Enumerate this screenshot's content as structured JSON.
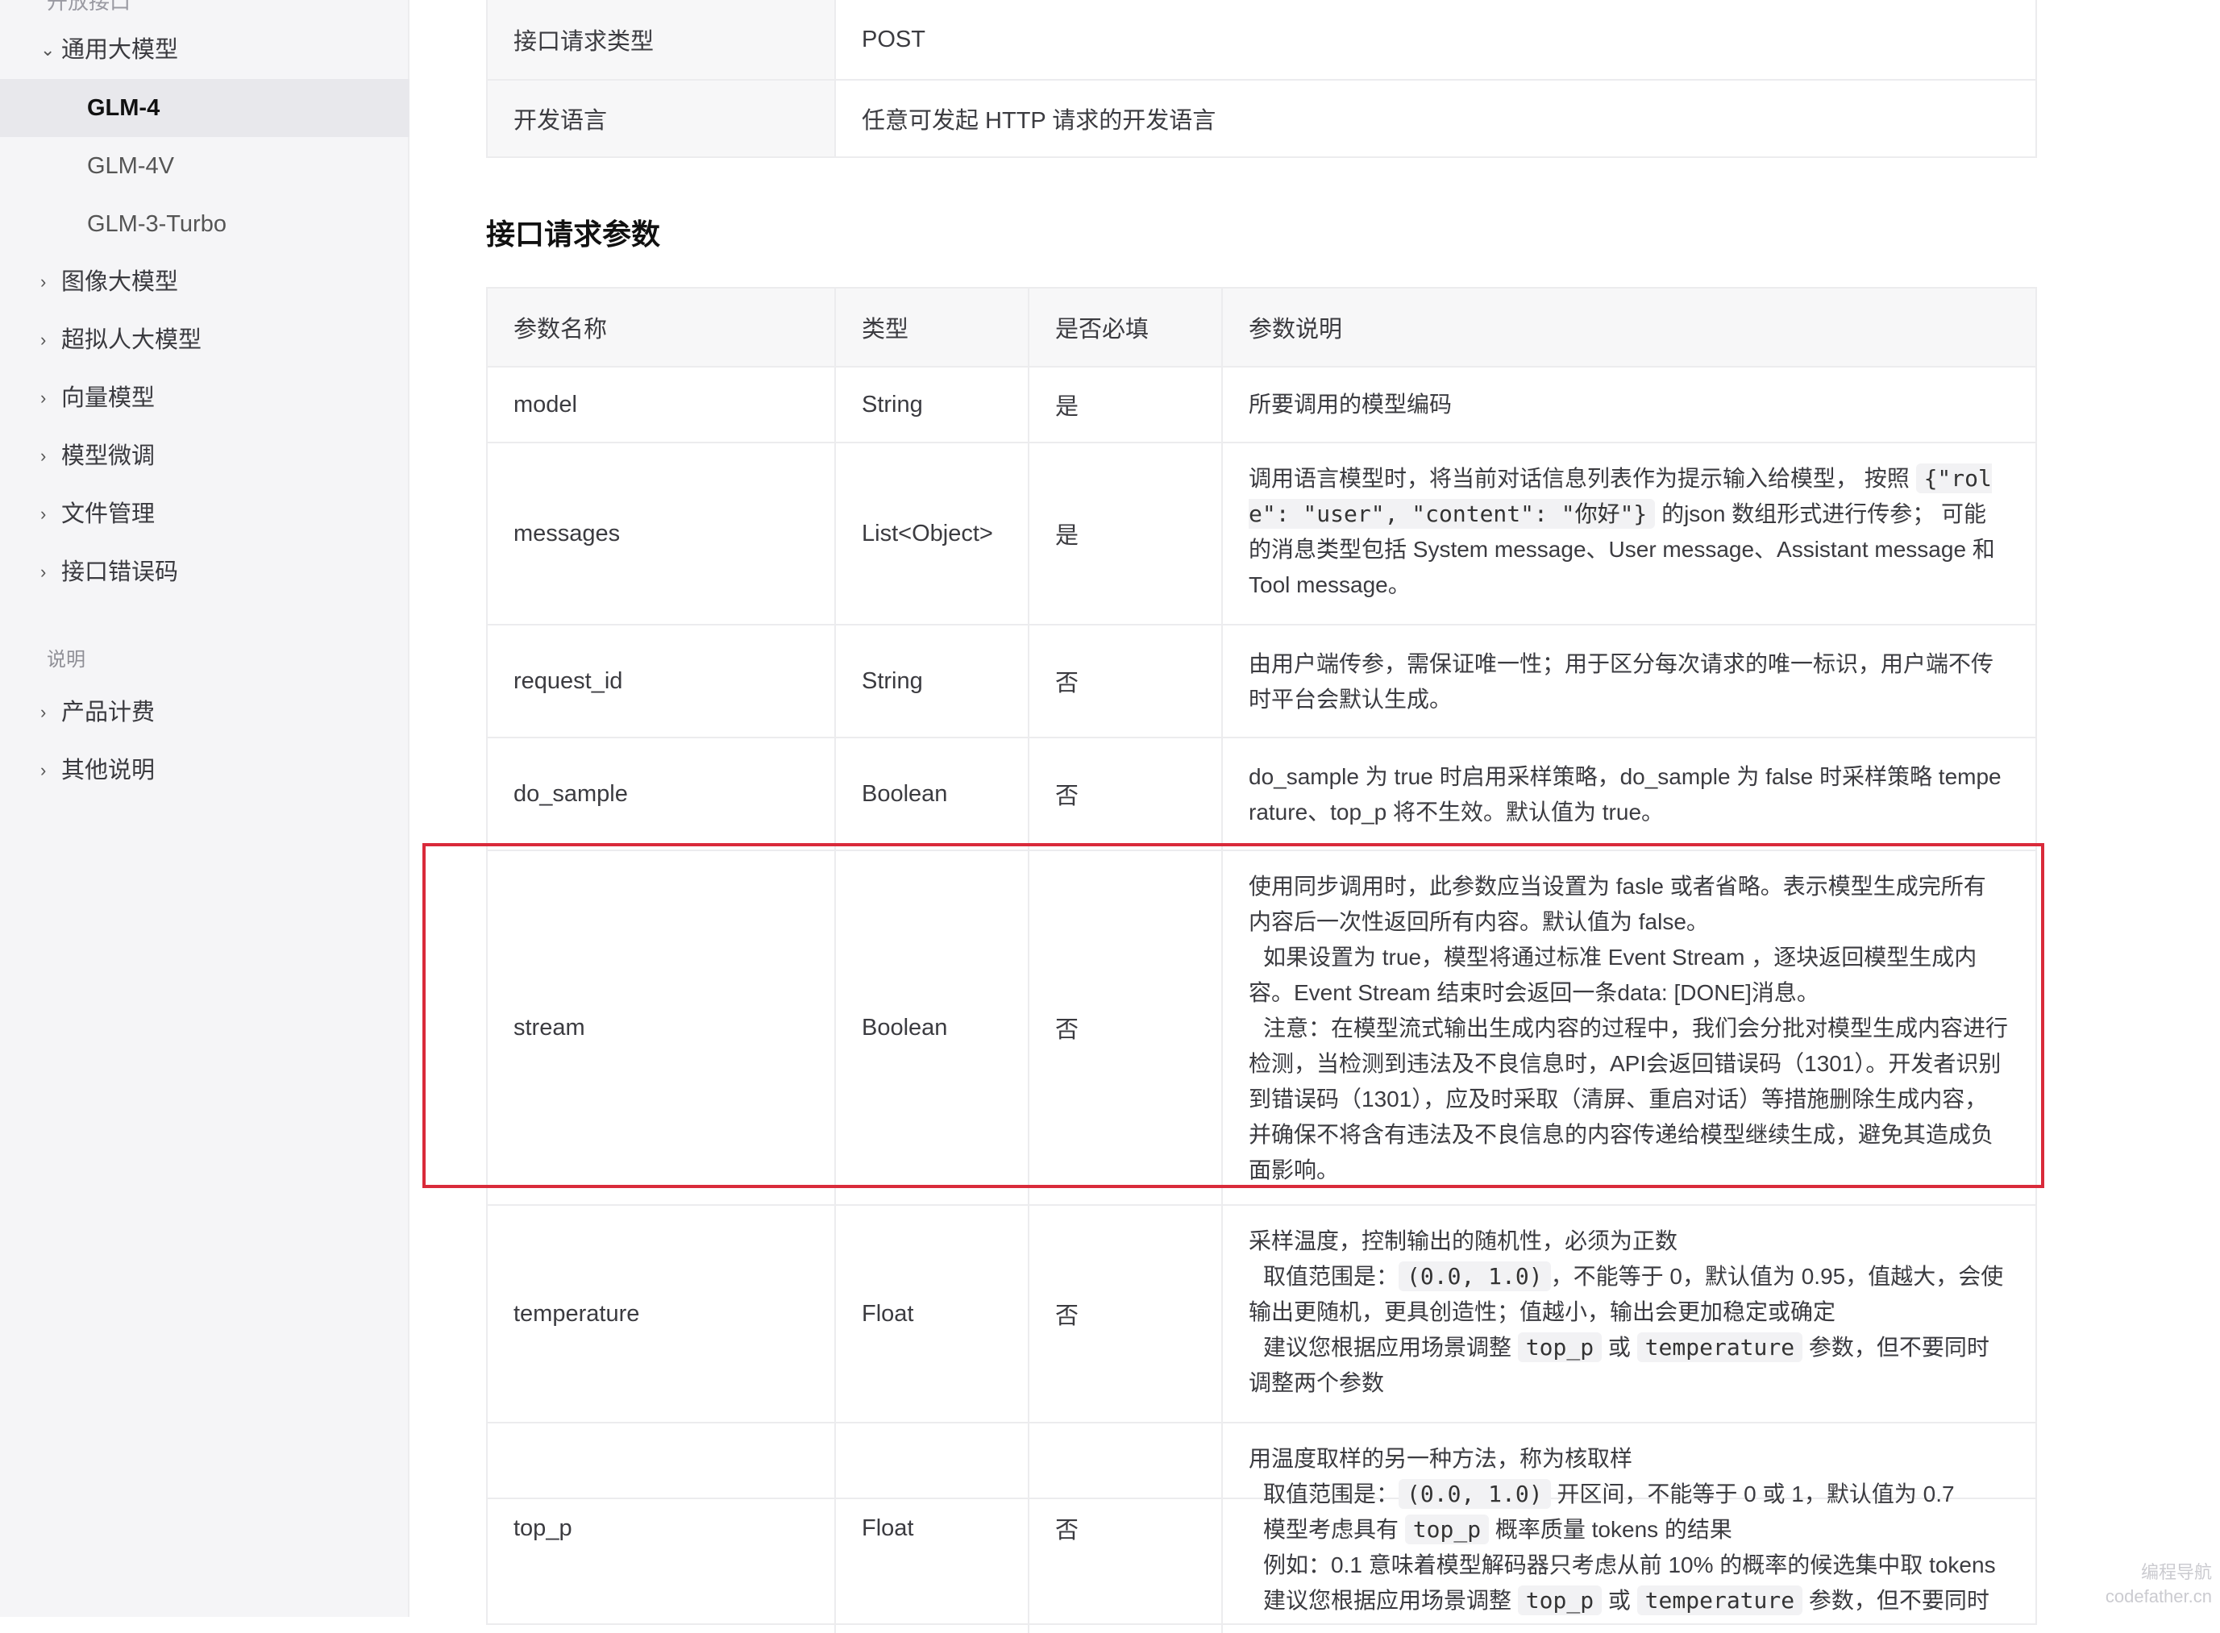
{
  "sidebar": {
    "top_cut_label": "开放接口",
    "groups": [
      {
        "label": "通用大模型",
        "expanded": true
      },
      {
        "label": "图像大模型"
      },
      {
        "label": "超拟人大模型"
      },
      {
        "label": "向量模型"
      },
      {
        "label": "模型微调"
      },
      {
        "label": "文件管理"
      },
      {
        "label": "接口错误码"
      }
    ],
    "sub_items": [
      "GLM-4",
      "GLM-4V",
      "GLM-3-Turbo"
    ],
    "active_sub_item": "GLM-4",
    "section_label": "说明",
    "section_items": [
      "产品计费",
      "其他说明"
    ]
  },
  "info_table": {
    "rows": [
      {
        "key": "接口请求类型",
        "value": "POST"
      },
      {
        "key": "开发语言",
        "value": "任意可发起 HTTP 请求的开发语言"
      }
    ]
  },
  "params_section_title": "接口请求参数",
  "param_table": {
    "headers": [
      "参数名称",
      "类型",
      "是否必填",
      "参数说明"
    ],
    "rows": [
      {
        "name": "model",
        "type": "String",
        "required": "是",
        "desc": [
          "所要调用的模型编码"
        ]
      },
      {
        "name": "messages",
        "type": "List<Object>",
        "required": "是",
        "desc_parts": {
          "a": "调用语言模型时，将当前对话信息列表作为提示输入给模型， 按照",
          "code": "{\"role\": \"user\", \"content\": \"你好\"}",
          "b": "的json 数组形式进行传参； 可能的消息类型包括 System message、User message、Assistant message 和 Tool message。"
        }
      },
      {
        "name": "request_id",
        "type": "String",
        "required": "否",
        "desc": [
          "由用户端传参，需保证唯一性；用于区分每次请求的唯一标识，用户端不传时平台会默认生成。"
        ]
      },
      {
        "name": "do_sample",
        "type": "Boolean",
        "required": "否",
        "desc": [
          "do_sample 为 true 时启用采样策略，do_sample 为 false 时采样策略 temperature、top_p 将不生效。默认值为 true。"
        ]
      },
      {
        "name": "stream",
        "type": "Boolean",
        "required": "否",
        "desc": [
          "使用同步调用时，此参数应当设置为 fasle 或者省略。表示模型生成完所有内容后一次性返回所有内容。默认值为 false。",
          "如果设置为 true，模型将通过标准 Event Stream ，逐块返回模型生成内容。Event Stream 结束时会返回一条data: [DONE]消息。",
          "注意：在模型流式输出生成内容的过程中，我们会分批对模型生成内容进行检测，当检测到违法及不良信息时，API会返回错误码（1301）。开发者识别到错误码（1301），应及时采取（清屏、重启对话）等措施删除生成内容，并确保不将含有违法及不良信息的内容传递给模型继续生成，避免其造成负面影响。"
        ]
      },
      {
        "name": "temperature",
        "type": "Float",
        "required": "否",
        "parts": {
          "l1": "采样温度，控制输出的随机性，必须为正数",
          "l2a": "取值范围是：",
          "l2code": "(0.0, 1.0)",
          "l2b": "，不能等于 0，默认值为 0.95，值越大，会使输出更随机，更具创造性；值越小，输出会更加稳定或确定",
          "l3a": "建议您根据应用场景调整",
          "l3code1": "top_p",
          "l3or": "或",
          "l3code2": "temperature",
          "l3b": "参数，但不要同时调整两个参数"
        }
      },
      {
        "name": "top_p",
        "type": "Float",
        "required": "否",
        "parts": {
          "l1": "用温度取样的另一种方法，称为核取样",
          "l2a": "取值范围是：",
          "l2code": "(0.0, 1.0)",
          "l2b": "开区间，不能等于 0 或 1，默认值为 0.7",
          "l3a": "模型考虑具有",
          "l3code": "top_p",
          "l3b": "概率质量 tokens 的结果",
          "l4": "例如：0.1 意味着模型解码器只考虑从前 10% 的概率的候选集中取 tokens",
          "l5a": "建议您根据应用场景调整",
          "l5code1": "top_p",
          "l5or": "或",
          "l5code2": "temperature",
          "l5b": "参数，但不要同时"
        }
      }
    ]
  },
  "watermark": {
    "line1": "编程导航",
    "line2": "codefather.cn"
  },
  "colors": {
    "highlight_border": "#d92a3a",
    "sidebar_bg": "#f5f5f7",
    "active_bg": "#e8e8ec"
  }
}
